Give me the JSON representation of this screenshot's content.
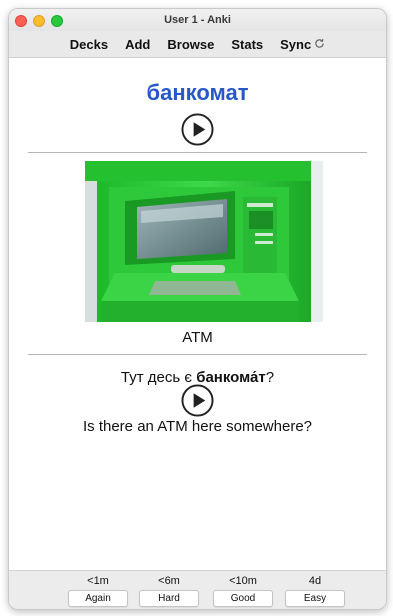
{
  "window": {
    "title": "User 1 - Anki"
  },
  "toolbar": {
    "items": [
      {
        "label": "Decks"
      },
      {
        "label": "Add"
      },
      {
        "label": "Browse"
      },
      {
        "label": "Stats"
      },
      {
        "label": "Sync"
      }
    ],
    "sync_icon": "sync-icon"
  },
  "card": {
    "word": "банкомат",
    "word_color": "#2858c8",
    "image_caption": "ATM",
    "sentence_prefix": "Тут десь є ",
    "sentence_bold": "банкома́т",
    "sentence_suffix": "?",
    "translation": "Is there an ATM here somewhere?",
    "audio_icon": "play-audio-icon"
  },
  "answer_buttons": [
    {
      "interval": "<1m",
      "label": "Again"
    },
    {
      "interval": "<6m",
      "label": "Hard"
    },
    {
      "interval": "<10m",
      "label": "Good"
    },
    {
      "interval": "4d",
      "label": "Easy"
    }
  ]
}
